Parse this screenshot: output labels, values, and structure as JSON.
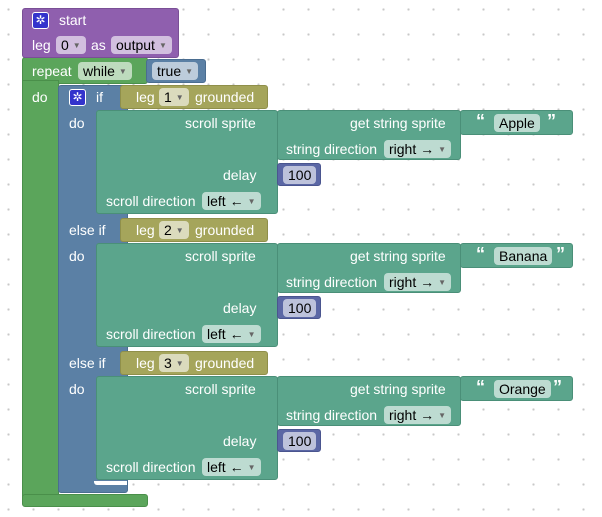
{
  "colors": {
    "start": "#8f5fae",
    "loop": "#5ba55b",
    "logic": "#5b80a5",
    "sensor": "#a5a55b",
    "display": "#5ba58c",
    "number": "#5b67a5"
  },
  "start": {
    "label": "start",
    "leg_label": "leg",
    "leg_value": "0",
    "as_label": "as",
    "mode_value": "output",
    "icon": "gear-icon"
  },
  "repeat": {
    "label": "repeat",
    "mode_value": "while",
    "condition_value": "true",
    "do_label": "do"
  },
  "if_block": {
    "if_label": "if",
    "else_if_label": "else if",
    "do_label": "do",
    "icon": "gear-icon"
  },
  "branches": [
    {
      "leg_label": "leg",
      "leg_value": "1",
      "grounded_label": "grounded",
      "scroll_sprite_label": "scroll sprite",
      "get_string_sprite_label": "get string sprite",
      "open_quote": "“",
      "text": "Apple",
      "close_quote": "”",
      "string_direction_label": "string direction",
      "string_direction_value": "right →",
      "delay_label": "delay",
      "delay_value": "100",
      "scroll_direction_label": "scroll direction",
      "scroll_direction_value": "left ←"
    },
    {
      "leg_label": "leg",
      "leg_value": "2",
      "grounded_label": "grounded",
      "scroll_sprite_label": "scroll sprite",
      "get_string_sprite_label": "get string sprite",
      "open_quote": "“",
      "text": "Banana",
      "close_quote": "”",
      "string_direction_label": "string direction",
      "string_direction_value": "right →",
      "delay_label": "delay",
      "delay_value": "100",
      "scroll_direction_label": "scroll direction",
      "scroll_direction_value": "left ←"
    },
    {
      "leg_label": "leg",
      "leg_value": "3",
      "grounded_label": "grounded",
      "scroll_sprite_label": "scroll sprite",
      "get_string_sprite_label": "get string sprite",
      "open_quote": "“",
      "text": "Orange",
      "close_quote": "”",
      "string_direction_label": "string direction",
      "string_direction_value": "right →",
      "delay_label": "delay",
      "delay_value": "100",
      "scroll_direction_label": "scroll direction",
      "scroll_direction_value": "left ←"
    }
  ]
}
